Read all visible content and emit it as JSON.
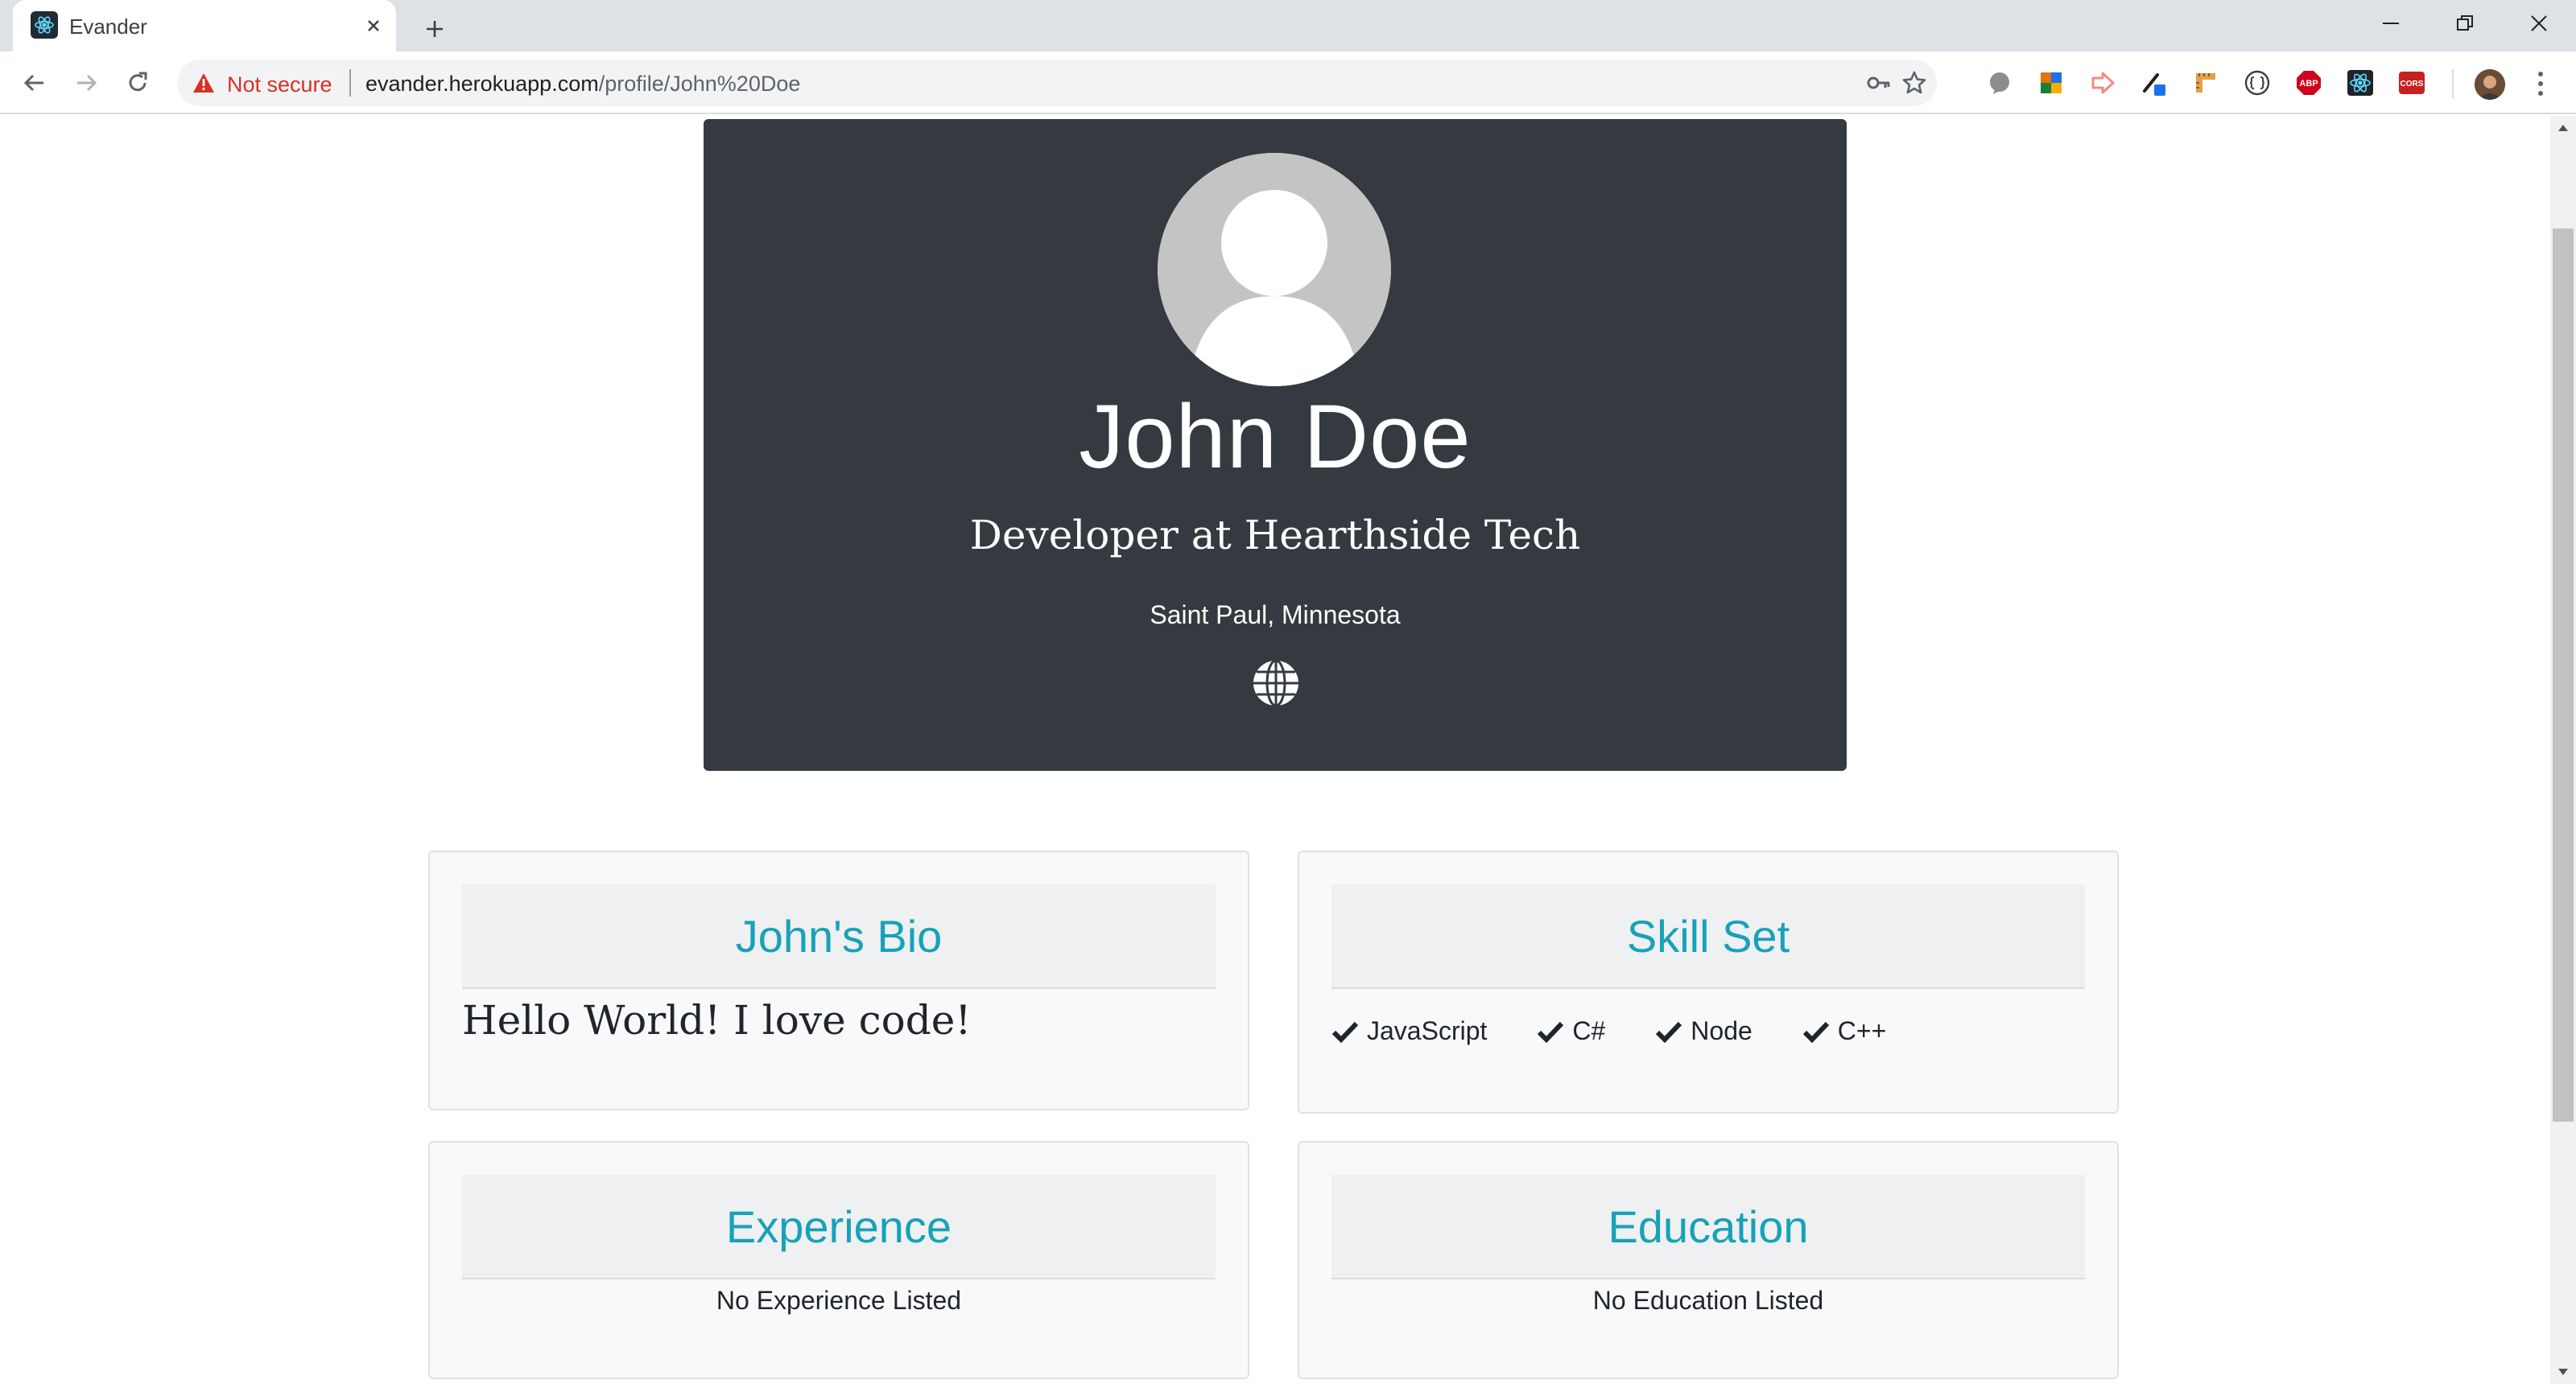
{
  "browser": {
    "tab_title": "Evander",
    "security_label": "Not secure",
    "url_host": "evander.herokuapp.com",
    "url_path": "/profile/John%20Doe"
  },
  "profile": {
    "name": "John Doe",
    "role": "Developer at Hearthside Tech",
    "location": "Saint Paul, Minnesota"
  },
  "bio": {
    "title": "John's Bio",
    "text": "Hello World! I love code!"
  },
  "skills": {
    "title": "Skill Set",
    "items": [
      "JavaScript",
      "C#",
      "Node",
      "C++"
    ]
  },
  "experience": {
    "title": "Experience",
    "empty_text": "No Experience Listed"
  },
  "education": {
    "title": "Education",
    "empty_text": "No Education Listed"
  },
  "colors": {
    "hero_bg": "#343a40",
    "accent": "#17a2b8",
    "not_secure": "#d93025"
  }
}
